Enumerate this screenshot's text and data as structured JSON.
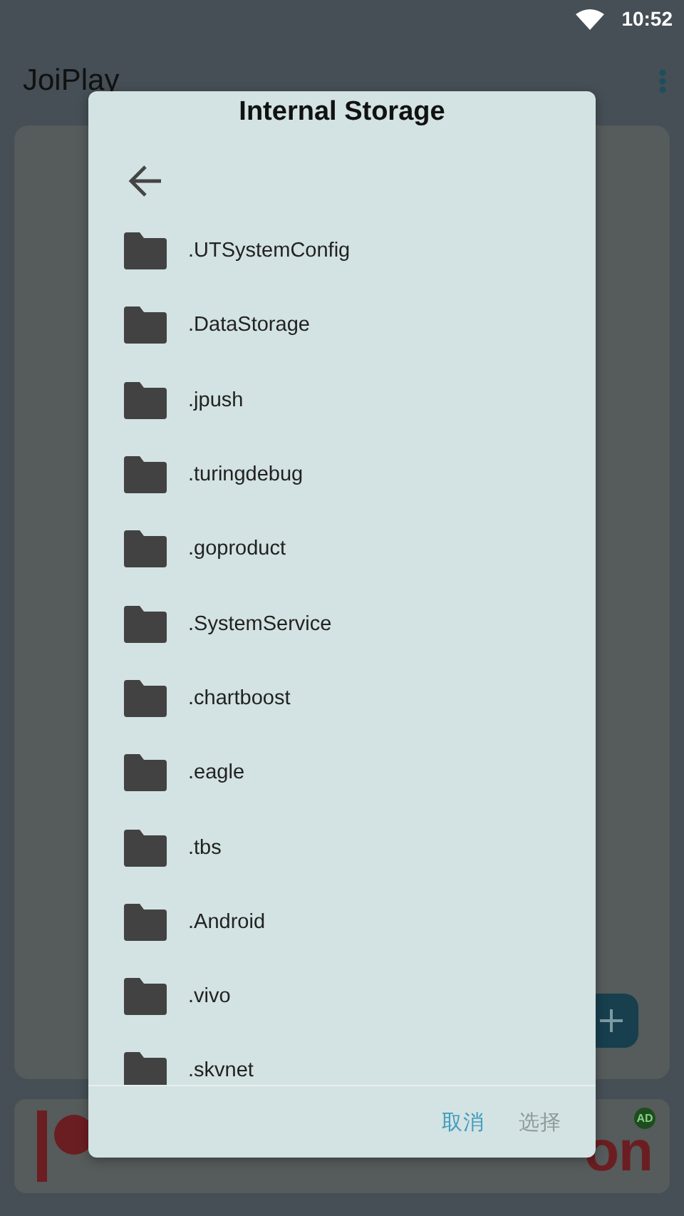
{
  "status_bar": {
    "time": "10:52"
  },
  "app_bar": {
    "title": "JoiPlay"
  },
  "ad_banner": {
    "text": "on",
    "badge": "AD"
  },
  "dialog": {
    "title": "Internal Storage",
    "folders": [
      {
        "name": ".UTSystemConfig"
      },
      {
        "name": ".DataStorage"
      },
      {
        "name": ".jpush"
      },
      {
        "name": ".turingdebug"
      },
      {
        "name": ".goproduct"
      },
      {
        "name": ".SystemService"
      },
      {
        "name": ".chartboost"
      },
      {
        "name": ".eagle"
      },
      {
        "name": ".tbs"
      },
      {
        "name": ".Android"
      },
      {
        "name": ".vivo"
      },
      {
        "name": ".skvnet"
      }
    ],
    "buttons": [
      {
        "label": "取消",
        "disabled": false
      },
      {
        "label": "选择",
        "disabled": true
      }
    ]
  }
}
